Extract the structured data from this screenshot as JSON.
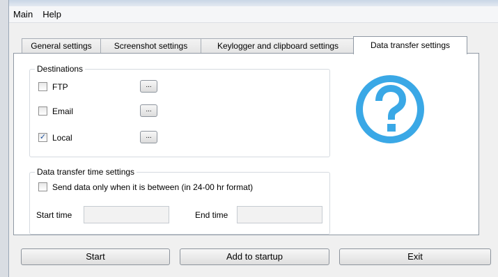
{
  "menubar": {
    "items": [
      "Main",
      "Help"
    ]
  },
  "tabs": [
    {
      "label": "General settings"
    },
    {
      "label": "Screenshot settings"
    },
    {
      "label": "Keylogger and clipboard settings"
    },
    {
      "label": "Data transfer settings",
      "active": true
    }
  ],
  "destinations": {
    "title": "Destinations",
    "items": [
      {
        "label": "FTP",
        "checked": false,
        "browse_label": "..."
      },
      {
        "label": "Email",
        "checked": false,
        "browse_label": "..."
      },
      {
        "label": "Local",
        "checked": true,
        "browse_label": "..."
      }
    ]
  },
  "time_settings": {
    "title": "Data transfer time settings",
    "send_only_between": {
      "label": "Send data only when it is between (in 24-00 hr format)",
      "checked": false
    },
    "start_time": {
      "label": "Start time",
      "value": ""
    },
    "end_time": {
      "label": "End time",
      "value": ""
    }
  },
  "help_icon": {
    "name": "question-mark-circle-icon",
    "color": "#3aa8e6"
  },
  "buttons": {
    "start": "Start",
    "add_to_startup": "Add to startup",
    "exit": "Exit"
  },
  "colors": {
    "window_bg": "#f0f0f0",
    "panel_bg": "#ffffff",
    "check_mark": "#1c4f9c"
  }
}
